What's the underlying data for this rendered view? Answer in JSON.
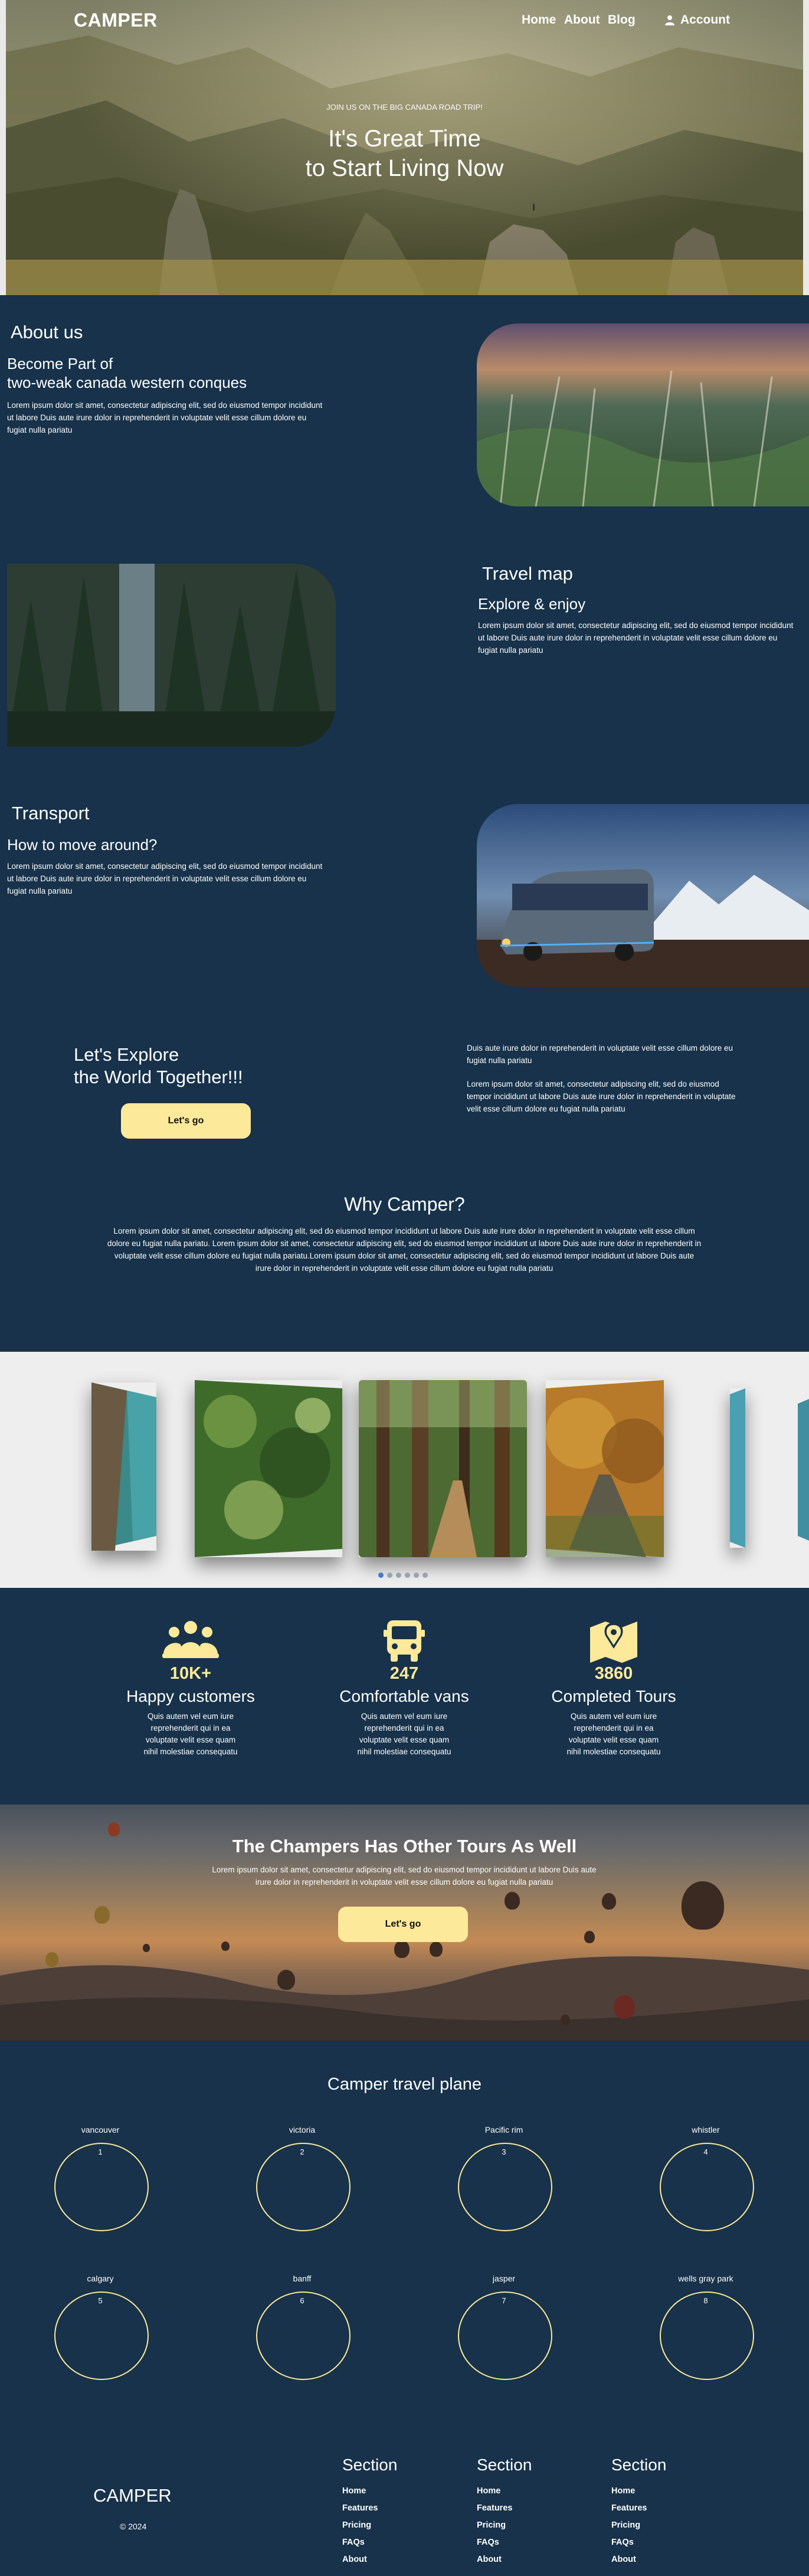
{
  "nav": {
    "logo": "CAMPER",
    "links": [
      "Home",
      "About",
      "Blog"
    ],
    "account": "Account"
  },
  "hero": {
    "kicker": "JOIN US ON THE BIG CANADA ROAD TRIP!",
    "title_line1": "It's Great Time",
    "title_line2": "to Start Living Now"
  },
  "about": {
    "heading": "About us",
    "subheading_line1": "Become Part of",
    "subheading_line2": "two-weak canada western conques",
    "text": "Lorem ipsum dolor sit amet, consectetur adipiscing elit, sed do eiusmod tempor incididunt ut labore Duis aute irure dolor in reprehenderit in voluptate velit esse cillum dolore eu fugiat nulla pariatu"
  },
  "travel_map": {
    "heading": "Travel map",
    "subheading": "Explore & enjoy",
    "text": "Lorem ipsum dolor sit amet, consectetur adipiscing elit, sed do eiusmod tempor incididunt ut labore Duis aute irure dolor in reprehenderit in voluptate velit esse cillum dolore eu fugiat nulla pariatu"
  },
  "transport": {
    "heading": "Transport",
    "subheading": "How to move around?",
    "text": "Lorem ipsum dolor sit amet, consectetur adipiscing elit, sed do eiusmod tempor incididunt ut labore Duis aute irure dolor in reprehenderit in voluptate velit esse cillum dolore eu fugiat nulla pariatu"
  },
  "explore": {
    "title_line1": "Let's Explore",
    "title_line2": "the World Together!!!",
    "button": "Let's go",
    "text1": "Duis aute irure dolor in reprehenderit in voluptate velit esse cillum dolore eu fugiat nulla pariatu",
    "text2": "Lorem ipsum dolor sit amet, consectetur adipiscing elit, sed do eiusmod tempor incididunt ut labore Duis aute irure dolor in reprehenderit in voluptate velit esse cillum dolore eu fugiat nulla pariatu"
  },
  "why": {
    "heading": "Why Camper?",
    "text": "Lorem ipsum dolor sit amet, consectetur adipiscing elit, sed do eiusmod tempor incididunt ut labore Duis aute irure dolor in reprehenderit in voluptate velit esse cillum dolore eu fugiat nulla pariatu. Lorem ipsum dolor sit amet, consectetur adipiscing elit, sed do eiusmod tempor incididunt ut labore Duis aute irure dolor in reprehenderit in voluptate velit esse cillum dolore eu fugiat nulla pariatu.Lorem ipsum dolor sit amet, consectetur adipiscing elit, sed do eiusmod tempor incididunt ut labore Duis aute irure dolor in reprehenderit in voluptate velit esse cillum dolore eu fugiat nulla pariatu"
  },
  "carousel": {
    "slides": [
      "coast",
      "forest-bokeh",
      "forest-path",
      "autumn-road",
      "beach"
    ],
    "dot_count": 6,
    "active_dot": 0
  },
  "stats": [
    {
      "icon": "group-icon",
      "value": "10K+",
      "label": "Happy customers",
      "text": "Quis autem vel eum iure reprehenderit qui in ea voluptate velit esse quam nihil molestiae consequatu"
    },
    {
      "icon": "bus-icon",
      "value": "247",
      "label": "Comfortable vans",
      "text": "Quis autem vel eum iure reprehenderit qui in ea voluptate velit esse quam nihil molestiae consequatu"
    },
    {
      "icon": "map-pin-icon",
      "value": "3860",
      "label": "Completed Tours",
      "text": "Quis autem vel eum iure reprehenderit qui in ea voluptate velit esse quam nihil molestiae consequatu"
    }
  ],
  "tours": {
    "heading": "The Champers Has Other Tours As Well",
    "text": "Lorem ipsum dolor sit amet, consectetur adipiscing elit, sed do eiusmod tempor incididunt ut labore Duis aute irure dolor in reprehenderit in voluptate velit esse cillum dolore eu fugiat nulla pariatu",
    "button": "Let's go"
  },
  "plan": {
    "heading": "Camper travel plane",
    "stops": [
      {
        "name": "vancouver",
        "num": "1"
      },
      {
        "name": "victoria",
        "num": "2"
      },
      {
        "name": "Pacific rim",
        "num": "3"
      },
      {
        "name": "whistler",
        "num": "4"
      },
      {
        "name": "calgary",
        "num": "5"
      },
      {
        "name": "banff",
        "num": "6"
      },
      {
        "name": "jasper",
        "num": "7"
      },
      {
        "name": "wells gray park",
        "num": "8"
      }
    ]
  },
  "footer": {
    "logo": "CAMPER",
    "copyright": "© 2024",
    "columns": [
      {
        "title": "Section",
        "links": [
          "Home",
          "Features",
          "Pricing",
          "FAQs",
          "About"
        ]
      },
      {
        "title": "Section",
        "links": [
          "Home",
          "Features",
          "Pricing",
          "FAQs",
          "About"
        ]
      },
      {
        "title": "Section",
        "links": [
          "Home",
          "Features",
          "Pricing",
          "FAQs",
          "About"
        ]
      }
    ]
  },
  "colors": {
    "background": "#17324a",
    "accent": "#fde99a",
    "carousel_bg": "#eeeeee"
  }
}
